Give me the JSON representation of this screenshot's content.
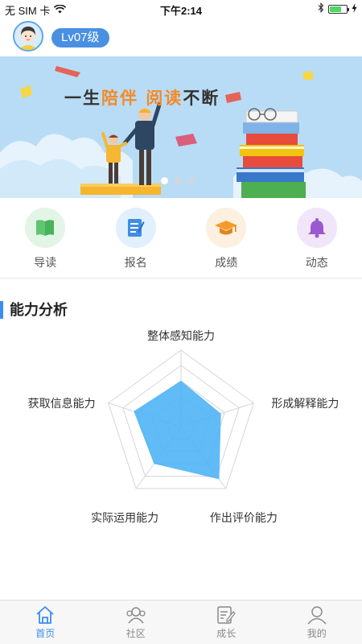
{
  "status_bar": {
    "carrier": "无 SIM 卡",
    "time": "下午2:14",
    "battery_level": 0.7
  },
  "header": {
    "level": "Lv07级"
  },
  "banner": {
    "title_part1": "一生",
    "title_part2": "陪伴",
    "title_part3": "阅读",
    "title_part4": "不断",
    "slide_count": 3,
    "active_slide": 1
  },
  "quick_menu": {
    "items": [
      {
        "label": "导读",
        "icon": "book-icon",
        "color": "#5fc56f",
        "bg": "#e3f5e6"
      },
      {
        "label": "报名",
        "icon": "signup-form-icon",
        "color": "#3f8de4",
        "bg": "#e2effc"
      },
      {
        "label": "成绩",
        "icon": "graduation-cap-icon",
        "color": "#f39a2b",
        "bg": "#fdf0e0"
      },
      {
        "label": "动态",
        "icon": "bell-icon",
        "color": "#9b59d0",
        "bg": "#f1e6f9"
      }
    ]
  },
  "ability": {
    "section_title": "能力分析",
    "axes": [
      "整体感知能力",
      "形成解释能力",
      "作出评价能力",
      "实际运用能力",
      "获取信息能力"
    ],
    "levels": 5,
    "values": [
      0.6,
      0.55,
      0.85,
      0.6,
      0.65
    ],
    "fill_color": "#4fb4f5"
  },
  "bottom_nav": {
    "items": [
      {
        "label": "首页",
        "icon": "home-icon",
        "active": true
      },
      {
        "label": "社区",
        "icon": "community-icon",
        "active": false
      },
      {
        "label": "成长",
        "icon": "growth-notes-icon",
        "active": false
      },
      {
        "label": "我的",
        "icon": "profile-icon",
        "active": false
      }
    ]
  },
  "colors": {
    "accent": "#3b8ef0",
    "badge": "#4a90e2"
  }
}
